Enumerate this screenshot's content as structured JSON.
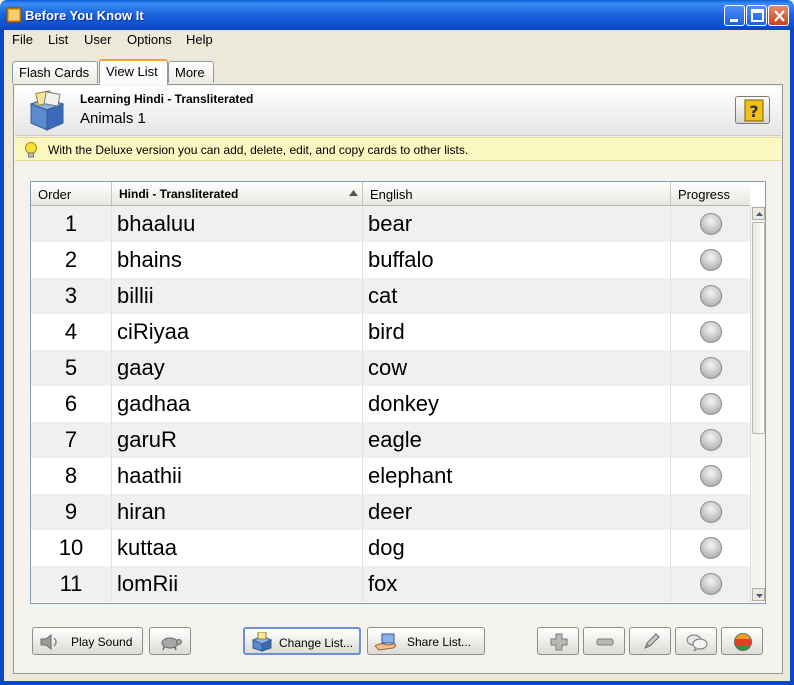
{
  "window": {
    "title": "Before You Know It"
  },
  "menu": [
    "File",
    "List",
    "User",
    "Options",
    "Help"
  ],
  "tabs": [
    {
      "label": "Flash Cards",
      "active": false
    },
    {
      "label": "View List",
      "active": true
    },
    {
      "label": "More",
      "active": false
    }
  ],
  "header": {
    "subtitle": "Learning Hindi - Transliterated",
    "list_name": "Animals 1"
  },
  "notice": "With the Deluxe version you can add, delete, edit, and copy cards to other lists.",
  "table": {
    "columns": [
      "Order",
      "Hindi - Transliterated",
      "English",
      "Progress"
    ],
    "sorted_column": "Hindi - Transliterated",
    "rows": [
      {
        "order": "1",
        "hindi": "bhaaluu",
        "english": "bear"
      },
      {
        "order": "2",
        "hindi": "bhains",
        "english": "buffalo"
      },
      {
        "order": "3",
        "hindi": "billii",
        "english": "cat"
      },
      {
        "order": "4",
        "hindi": "ciRiyaa",
        "english": "bird"
      },
      {
        "order": "5",
        "hindi": "gaay",
        "english": "cow"
      },
      {
        "order": "6",
        "hindi": "gadhaa",
        "english": "donkey"
      },
      {
        "order": "7",
        "hindi": "garuR",
        "english": "eagle"
      },
      {
        "order": "8",
        "hindi": "haathii",
        "english": "elephant"
      },
      {
        "order": "9",
        "hindi": "hiran",
        "english": "deer"
      },
      {
        "order": "10",
        "hindi": "kuttaa",
        "english": "dog"
      },
      {
        "order": "11",
        "hindi": "lomRii",
        "english": "fox"
      }
    ]
  },
  "buttons": {
    "play_sound": "Play Sound",
    "change_list": "Change List...",
    "share_list": "Share List..."
  },
  "colors": {
    "titlebar": "#1d66e0",
    "notice_bg": "#fbf7c0",
    "tab_accent": "#f3a53a"
  }
}
